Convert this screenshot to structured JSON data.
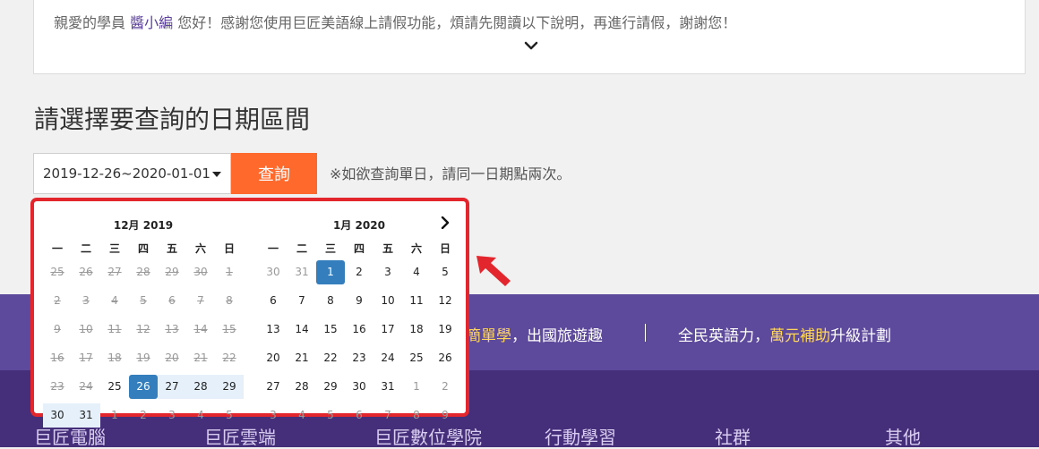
{
  "notice": {
    "prefix": "親愛的學員 ",
    "username": "醬小編",
    "suffix": " 您好！感謝您使用巨匠美語線上請假功能，煩請先閱讀以下說明，再進行請假，謝謝您！"
  },
  "section_title": "請選擇要查詢的日期區間",
  "date_range": {
    "value": "2019-12-26~2020-01-01"
  },
  "query_button": "查詢",
  "hint": "※如欲查詢單日，請同一日期點兩次。",
  "weekdays": [
    "一",
    "二",
    "三",
    "四",
    "五",
    "六",
    "日"
  ],
  "calendar": {
    "left": {
      "title": "12月 2019",
      "weeks": [
        [
          {
            "d": "25",
            "s": "disabled"
          },
          {
            "d": "26",
            "s": "disabled"
          },
          {
            "d": "27",
            "s": "disabled"
          },
          {
            "d": "28",
            "s": "disabled"
          },
          {
            "d": "29",
            "s": "disabled"
          },
          {
            "d": "30",
            "s": "disabled"
          },
          {
            "d": "1",
            "s": "disabled"
          }
        ],
        [
          {
            "d": "2",
            "s": "disabled"
          },
          {
            "d": "3",
            "s": "disabled"
          },
          {
            "d": "4",
            "s": "disabled"
          },
          {
            "d": "5",
            "s": "disabled"
          },
          {
            "d": "6",
            "s": "disabled"
          },
          {
            "d": "7",
            "s": "disabled"
          },
          {
            "d": "8",
            "s": "disabled"
          }
        ],
        [
          {
            "d": "9",
            "s": "disabled"
          },
          {
            "d": "10",
            "s": "disabled"
          },
          {
            "d": "11",
            "s": "disabled"
          },
          {
            "d": "12",
            "s": "disabled"
          },
          {
            "d": "13",
            "s": "disabled"
          },
          {
            "d": "14",
            "s": "disabled"
          },
          {
            "d": "15",
            "s": "disabled"
          }
        ],
        [
          {
            "d": "16",
            "s": "disabled"
          },
          {
            "d": "17",
            "s": "disabled"
          },
          {
            "d": "18",
            "s": "disabled"
          },
          {
            "d": "19",
            "s": "disabled"
          },
          {
            "d": "20",
            "s": "disabled"
          },
          {
            "d": "21",
            "s": "disabled"
          },
          {
            "d": "22",
            "s": "disabled"
          }
        ],
        [
          {
            "d": "23",
            "s": "disabled"
          },
          {
            "d": "24",
            "s": "disabled"
          },
          {
            "d": "25",
            "s": ""
          },
          {
            "d": "26",
            "s": "active"
          },
          {
            "d": "27",
            "s": "range"
          },
          {
            "d": "28",
            "s": "range"
          },
          {
            "d": "29",
            "s": "range"
          }
        ],
        [
          {
            "d": "30",
            "s": "range"
          },
          {
            "d": "31",
            "s": "range"
          },
          {
            "d": "1",
            "s": "off"
          },
          {
            "d": "2",
            "s": "off"
          },
          {
            "d": "3",
            "s": "off"
          },
          {
            "d": "4",
            "s": "off"
          },
          {
            "d": "5",
            "s": "off"
          }
        ]
      ]
    },
    "right": {
      "title": "1月 2020",
      "weeks": [
        [
          {
            "d": "30",
            "s": "off"
          },
          {
            "d": "31",
            "s": "off"
          },
          {
            "d": "1",
            "s": "active"
          },
          {
            "d": "2",
            "s": ""
          },
          {
            "d": "3",
            "s": ""
          },
          {
            "d": "4",
            "s": ""
          },
          {
            "d": "5",
            "s": ""
          }
        ],
        [
          {
            "d": "6",
            "s": ""
          },
          {
            "d": "7",
            "s": ""
          },
          {
            "d": "8",
            "s": ""
          },
          {
            "d": "9",
            "s": ""
          },
          {
            "d": "10",
            "s": ""
          },
          {
            "d": "11",
            "s": ""
          },
          {
            "d": "12",
            "s": ""
          }
        ],
        [
          {
            "d": "13",
            "s": ""
          },
          {
            "d": "14",
            "s": ""
          },
          {
            "d": "15",
            "s": ""
          },
          {
            "d": "16",
            "s": ""
          },
          {
            "d": "17",
            "s": ""
          },
          {
            "d": "18",
            "s": ""
          },
          {
            "d": "19",
            "s": ""
          }
        ],
        [
          {
            "d": "20",
            "s": ""
          },
          {
            "d": "21",
            "s": ""
          },
          {
            "d": "22",
            "s": ""
          },
          {
            "d": "23",
            "s": ""
          },
          {
            "d": "24",
            "s": ""
          },
          {
            "d": "25",
            "s": ""
          },
          {
            "d": "26",
            "s": ""
          }
        ],
        [
          {
            "d": "27",
            "s": ""
          },
          {
            "d": "28",
            "s": ""
          },
          {
            "d": "29",
            "s": ""
          },
          {
            "d": "30",
            "s": ""
          },
          {
            "d": "31",
            "s": ""
          },
          {
            "d": "1",
            "s": "off"
          },
          {
            "d": "2",
            "s": "off"
          }
        ],
        [
          {
            "d": "3",
            "s": "off"
          },
          {
            "d": "4",
            "s": "off"
          },
          {
            "d": "5",
            "s": "off"
          },
          {
            "d": "6",
            "s": "off"
          },
          {
            "d": "7",
            "s": "off"
          },
          {
            "d": "8",
            "s": "off"
          },
          {
            "d": "9",
            "s": "off"
          }
        ]
      ]
    }
  },
  "banner": {
    "left_hl": "簡單學",
    "left_rest": "，出國旅遊趣",
    "right_pre": "全民英語力，",
    "right_hl": "萬元補助",
    "right_rest": "升級計劃"
  },
  "footer_links": [
    "巨匠電腦",
    "巨匠雲端",
    "巨匠數位學院",
    "行動學習",
    "社群",
    "其他"
  ],
  "colors": {
    "accent_orange": "#ff6a2c",
    "selected_blue": "#357ebd",
    "range_blue": "#e6f0fa",
    "highlight_red": "#e3262e",
    "banner_purple": "#5e4a9d",
    "footer_purple": "#452f7a",
    "banner_highlight": "#ffd65c"
  }
}
